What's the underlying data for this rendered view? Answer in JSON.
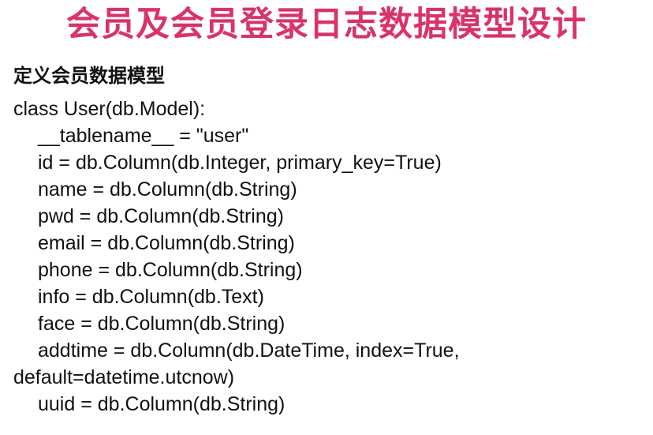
{
  "slide": {
    "title": "会员及会员登录日志数据模型设计",
    "title_color": "#d9336b",
    "subtitle": "定义会员数据模型",
    "code_lines": [
      {
        "text": "class User(db.Model):",
        "indent": false
      },
      {
        "text": "__tablename__ = \"user\"",
        "indent": true
      },
      {
        "text": "id = db.Column(db.Integer, primary_key=True)",
        "indent": true
      },
      {
        "text": "name = db.Column(db.String)",
        "indent": true
      },
      {
        "text": "pwd = db.Column(db.String)",
        "indent": true
      },
      {
        "text": "email = db.Column(db.String)",
        "indent": true
      },
      {
        "text": "phone = db.Column(db.String)",
        "indent": true
      },
      {
        "text": "info = db.Column(db.Text)",
        "indent": true
      },
      {
        "text": "face = db.Column(db.String)",
        "indent": true
      },
      {
        "text": "addtime = db.Column(db.DateTime, index=True,",
        "indent": true
      },
      {
        "text": "default=datetime.utcnow)",
        "indent": false
      },
      {
        "text": "uuid = db.Column(db.String)",
        "indent": true
      }
    ]
  }
}
